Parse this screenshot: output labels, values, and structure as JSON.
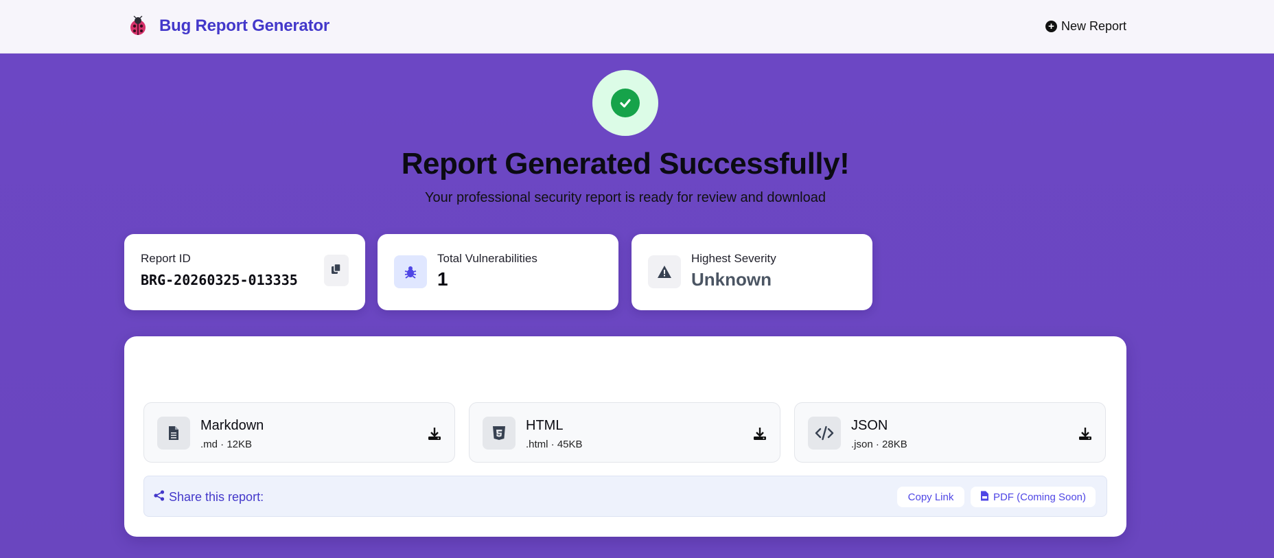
{
  "header": {
    "app_title": "Bug Report Generator",
    "logo_icon": "ladybug-icon",
    "new_report_label": "New Report"
  },
  "hero": {
    "icon": "check-circle-icon",
    "title": "Report Generated Successfully!",
    "subtitle": "Your professional security report is ready for review and download"
  },
  "stats": {
    "report_id_label": "Report ID",
    "report_id_value": "BRG-20260325-013335",
    "total_vuln_label": "Total Vulnerabilities",
    "total_vuln_value": "1",
    "severity_label": "Highest Severity",
    "severity_value": "Unknown"
  },
  "downloads": [
    {
      "name": "Markdown",
      "meta": ".md · 12KB",
      "icon": "file-text-icon"
    },
    {
      "name": "HTML",
      "meta": ".html · 45KB",
      "icon": "html5-icon"
    },
    {
      "name": "JSON",
      "meta": ".json · 28KB",
      "icon": "code-icon"
    }
  ],
  "share": {
    "label": "Share this report:",
    "copy_link_label": "Copy Link",
    "pdf_label": "PDF (Coming Soon)"
  },
  "colors": {
    "background": "#6b46c1",
    "accent": "#4338ca",
    "success": "#16a34a",
    "success_bg": "#dcfce7"
  }
}
